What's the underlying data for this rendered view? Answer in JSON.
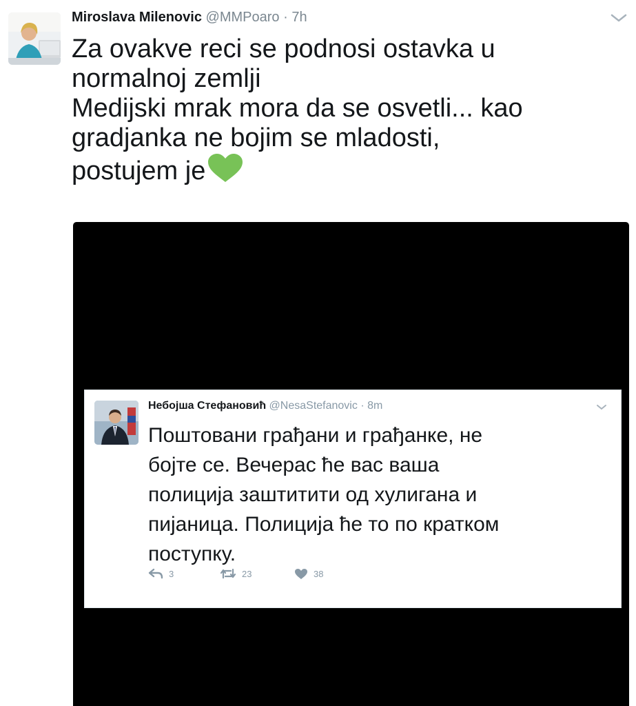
{
  "tweet": {
    "author_name": "Miroslava Milenovic",
    "author_handle": "@MMPoaro",
    "separator": "·",
    "time": "7h",
    "text_lines": [
      "Za ovakve reci se podnosi ostavka u",
      "normalnoj zemlji",
      "Medijski mrak mora da se osvetli... kao",
      "gradjanka ne bojim se mladosti,",
      "postujem je"
    ],
    "emoji": "green-heart-icon",
    "media_background": "#000000"
  },
  "embedded_tweet": {
    "author_name": "Небојша Стефановић",
    "author_handle": "@NesaStefanovic",
    "separator": "·",
    "time": "8m",
    "text_lines": [
      "Поштовани грађани и грађанке, не",
      "бојте се. Вечерас ће вас ваша",
      "полиција заштитити од хулигана и",
      "пијаница. Полиција ће то по кратком",
      "поступку."
    ],
    "actions": {
      "reply_count": "3",
      "retweet_count": "23",
      "like_count": "38"
    }
  },
  "colors": {
    "text": "#14171a",
    "muted": "#8899a6",
    "heart": "#78c257"
  }
}
